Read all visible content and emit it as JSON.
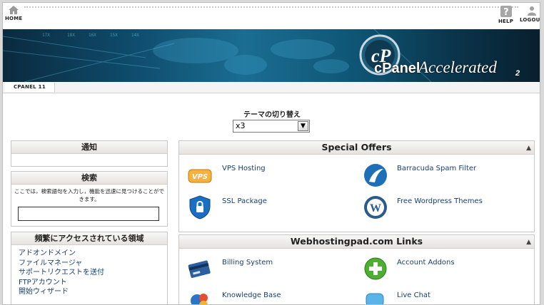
{
  "topbar": {
    "home_label": "HOME",
    "help_label": "HELP",
    "logout_label": "LOGOUT"
  },
  "banner": {
    "brand_c": "cPanel",
    "brand_text": "Accelerated",
    "brand_version": "2",
    "logo_letters": "cP"
  },
  "breadcrumb": {
    "label": "CPANEL 11"
  },
  "theme": {
    "label": "テーマの切り替え",
    "selected": "x3",
    "arrow": "▼"
  },
  "notice_box": {
    "title": "通知"
  },
  "search_box": {
    "title": "検索",
    "description": "ここでは，検索語句を入力し，機能を迅速に見つけることができます。",
    "input_value": ""
  },
  "frequent_box": {
    "title": "頻繁にアクセスされている領域",
    "items": [
      "アドオンドメイン",
      "ファイルマネージャ",
      "サポートリクエストを送付",
      "FTPアカウント",
      "開始ウィザード"
    ]
  },
  "special_offers": {
    "title": "Special Offers",
    "collapse": "▲",
    "items": [
      {
        "label": "VPS Hosting",
        "icon": "vps-icon",
        "icon_text": "VPS"
      },
      {
        "label": "Barracuda Spam Filter",
        "icon": "barracuda-icon"
      },
      {
        "label": "SSL Package",
        "icon": "ssl-shield-icon"
      },
      {
        "label": "Free Wordpress Themes",
        "icon": "wordpress-icon",
        "icon_text": "W"
      }
    ]
  },
  "links_panel": {
    "title": "Webhostingpad.com Links",
    "collapse": "▲",
    "items": [
      {
        "label": "Billing System",
        "icon": "billing-card-icon"
      },
      {
        "label": "Account Addons",
        "icon": "add-plus-icon",
        "icon_text": "+"
      },
      {
        "label": "Knowledge Base",
        "icon": "knowledge-base-icon"
      },
      {
        "label": "Live Chat",
        "icon": "live-chat-icon"
      }
    ]
  },
  "colors": {
    "link": "#1a3f6b",
    "banner_blue": "#0f4d6e",
    "panel_header": "#e6e2df"
  }
}
